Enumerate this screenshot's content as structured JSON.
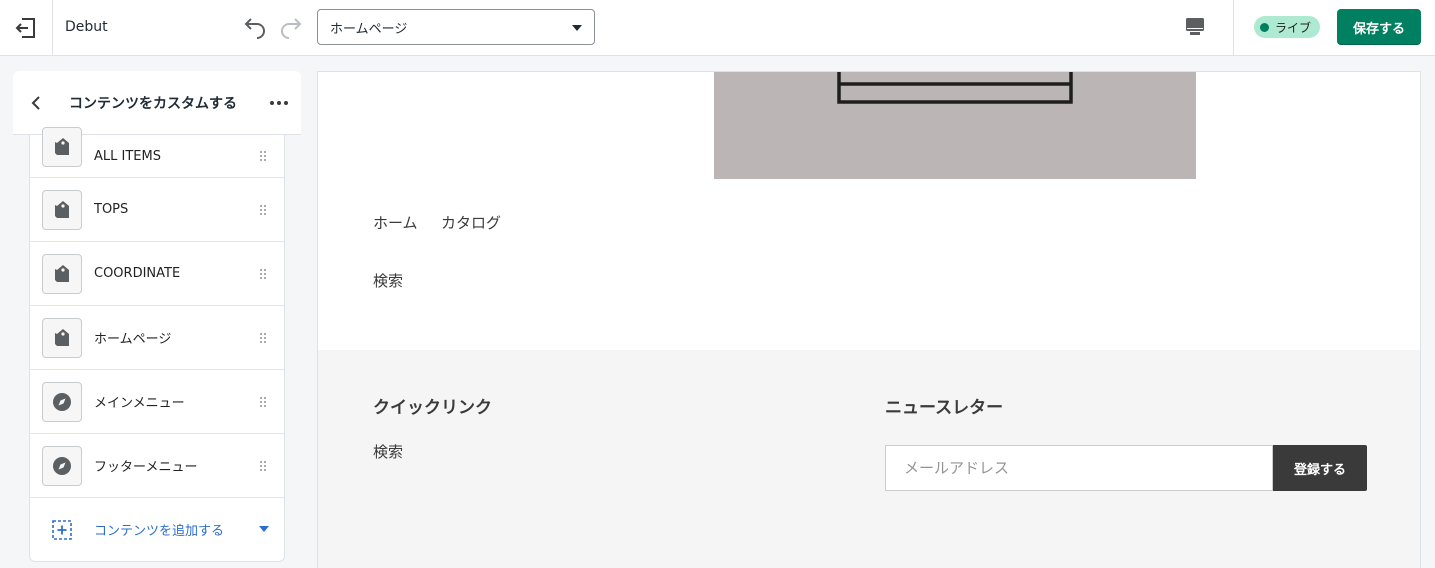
{
  "topbar": {
    "theme_name": "Debut",
    "page_select_value": "ホームページ",
    "live_label": "ライブ",
    "save_label": "保存する"
  },
  "sidebar": {
    "title": "コンテンツをカスタムする",
    "items": [
      {
        "label": "ALL ITEMS",
        "icon": "collection-tag-icon"
      },
      {
        "label": "TOPS",
        "icon": "collection-tag-icon"
      },
      {
        "label": "COORDINATE",
        "icon": "collection-tag-icon"
      },
      {
        "label": "ホームページ",
        "icon": "collection-tag-icon"
      },
      {
        "label": "メインメニュー",
        "icon": "compass-icon"
      },
      {
        "label": "フッターメニュー",
        "icon": "compass-icon"
      }
    ],
    "add_content_label": "コンテンツを追加する"
  },
  "preview": {
    "nav_links": [
      "ホーム",
      "カタログ"
    ],
    "search_link": "検索",
    "footer": {
      "quick_links_heading": "クイックリンク",
      "quick_links": [
        "検索"
      ],
      "newsletter_heading": "ニュースレター",
      "email_placeholder": "メールアドレス",
      "subscribe_label": "登録する"
    }
  },
  "colors": {
    "accent": "#008060",
    "live_badge_bg": "#aee9d1",
    "link_blue": "#2c6ecb",
    "hero_bg": "#bcb5b6",
    "footer_bg": "#f5f5f5",
    "subscribe_bg": "#3a3a3a"
  }
}
